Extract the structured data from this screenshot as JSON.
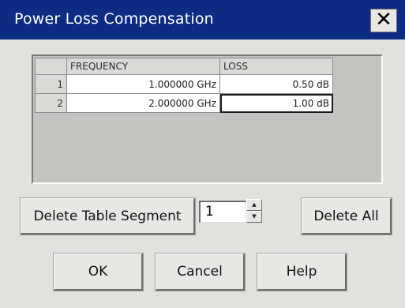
{
  "window": {
    "title": "Power Loss Compensation",
    "close_glyph": "✕"
  },
  "table": {
    "columns": [
      "FREQUENCY",
      "LOSS"
    ],
    "rows": [
      {
        "index": "1",
        "frequency": "1.000000 GHz",
        "loss": "0.50 dB"
      },
      {
        "index": "2",
        "frequency": "2.000000 GHz",
        "loss": "1.00 dB"
      }
    ]
  },
  "segment_controls": {
    "delete_segment_label": "Delete Table Segment",
    "segment_value": "1",
    "spin_up_glyph": "▲",
    "spin_down_glyph": "▼",
    "delete_all_label": "Delete All"
  },
  "footer": {
    "ok_label": "OK",
    "cancel_label": "Cancel",
    "help_label": "Help"
  }
}
